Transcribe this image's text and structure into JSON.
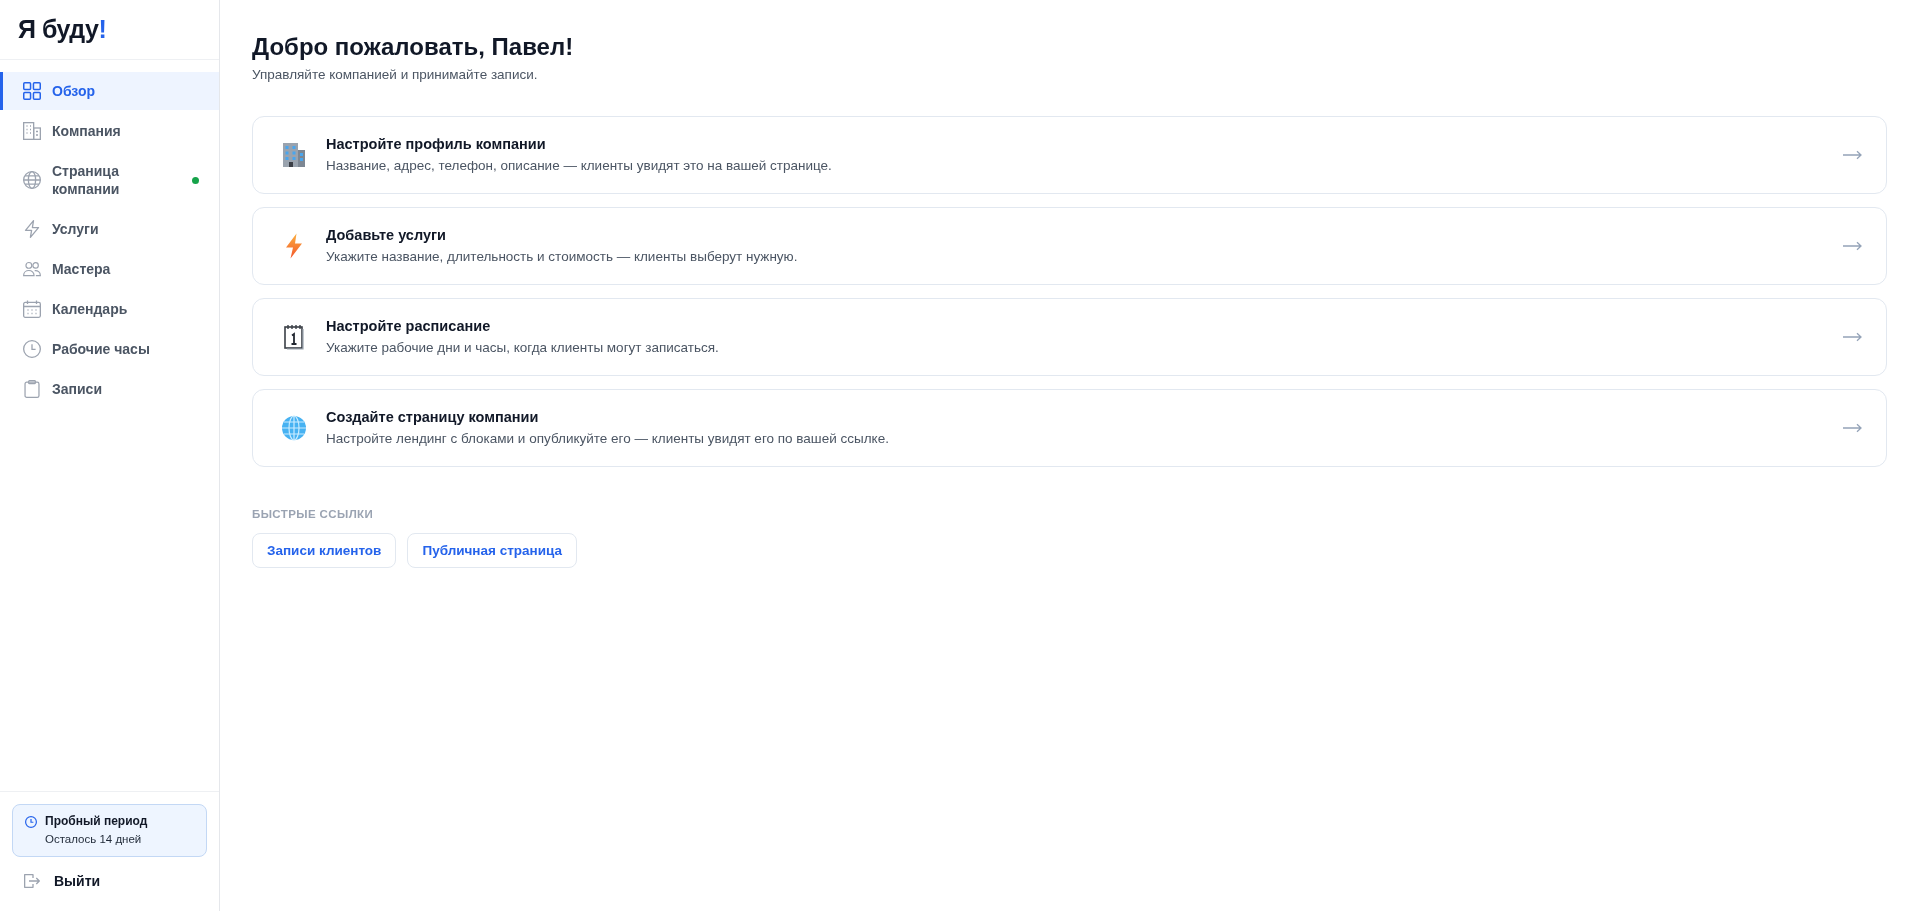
{
  "sidebar": {
    "logo": {
      "text": "Я буду",
      "accent": "!"
    },
    "items": [
      {
        "label": "Обзор",
        "selected": true,
        "status_dot": false
      },
      {
        "label": "Компания",
        "selected": false,
        "status_dot": false
      },
      {
        "label": "Страница компании",
        "selected": false,
        "status_dot": true
      },
      {
        "label": "Услуги",
        "selected": false,
        "status_dot": false
      },
      {
        "label": "Мастера",
        "selected": false,
        "status_dot": false
      },
      {
        "label": "Календарь",
        "selected": false,
        "status_dot": false
      },
      {
        "label": "Рабочие часы",
        "selected": false,
        "status_dot": false
      },
      {
        "label": "Записи",
        "selected": false,
        "status_dot": false
      }
    ],
    "trial": {
      "title": "Пробный период",
      "subtitle": "Осталось 14 дней"
    },
    "logout": "Выйти"
  },
  "main": {
    "title": "Добро пожаловать, Павел!",
    "subtitle": "Управляйте компанией и принимайте записи.",
    "steps": [
      {
        "title": "Настройте профиль компании",
        "description": "Название, адрес, телефон, описание — клиенты увидят это на вашей странице."
      },
      {
        "title": "Добавьте услуги",
        "description": "Укажите название, длительность и стоимость — клиенты выберут нужную."
      },
      {
        "title": "Настройте расписание",
        "description": "Укажите рабочие дни и часы, когда клиенты могут записаться."
      },
      {
        "title": "Создайте страницу компании",
        "description": "Настройте лендинг с блоками и опубликуйте его — клиенты увидят его по вашей ссылке."
      }
    ],
    "quick_links": {
      "heading": "БЫСТРЫЕ ССЫЛКИ",
      "links": [
        "Записи клиентов",
        "Публичная страница"
      ]
    }
  }
}
